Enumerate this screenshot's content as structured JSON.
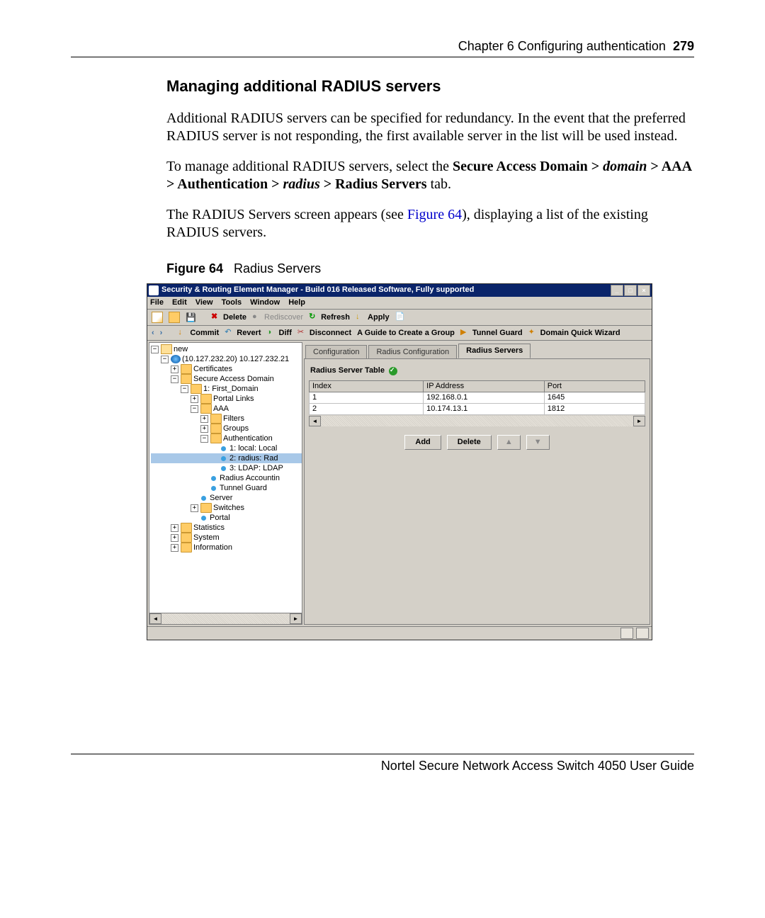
{
  "header": {
    "chapter": "Chapter 6  Configuring authentication",
    "pagenum": "279"
  },
  "section": {
    "title": "Managing additional RADIUS servers"
  },
  "para1": "Additional RADIUS servers can be specified for redundancy. In the event that the preferred RADIUS server is not responding, the first available server in the list will be used instead.",
  "para2_a": "To manage additional RADIUS servers, select the ",
  "para2_b1": "Secure Access Domain > ",
  "para2_b2": "domain",
  "para2_b3": " > AAA > Authentication > ",
  "para2_b4": "radius",
  "para2_b5": " > Radius Servers",
  "para2_b6": " tab.",
  "para3_a": "The RADIUS Servers screen appears (see ",
  "para3_ref": "Figure 64",
  "para3_b": "), displaying a list of the existing RADIUS servers.",
  "figure": {
    "num": "Figure 64",
    "title": "Radius Servers"
  },
  "footer": "Nortel Secure Network Access Switch 4050 User Guide",
  "app": {
    "title": "Security & Routing Element Manager - Build 016 Released Software, Fully supported",
    "menubar": [
      "File",
      "Edit",
      "View",
      "Tools",
      "Window",
      "Help"
    ],
    "toolbar1": {
      "delete": "Delete",
      "rediscover": "Rediscover",
      "refresh": "Refresh",
      "apply": "Apply"
    },
    "toolbar2": {
      "commit": "Commit",
      "revert": "Revert",
      "diff": "Diff",
      "disconnect": "Disconnect",
      "guide": "A Guide to Create a Group",
      "tunnel": "Tunnel Guard",
      "wizard": "Domain Quick Wizard"
    },
    "tree": {
      "root": "new",
      "device": "(10.127.232.20) 10.127.232.21",
      "certs": "Certificates",
      "sad": "Secure Access Domain",
      "domain": "1: First_Domain",
      "portal_links": "Portal Links",
      "aaa": "AAA",
      "filters": "Filters",
      "groups": "Groups",
      "auth": "Authentication",
      "auth1": "1: local: Local",
      "auth2": "2: radius: Rad",
      "auth3": "3: LDAP: LDAP",
      "radacct": "Radius Accountin",
      "tunguard": "Tunnel Guard",
      "server": "Server",
      "switches": "Switches",
      "portal": "Portal",
      "stats": "Statistics",
      "system": "System",
      "info": "Information"
    },
    "tabs": {
      "t1": "Configuration",
      "t2": "Radius Configuration",
      "t3": "Radius Servers"
    },
    "panel": {
      "label": "Radius Server Table",
      "cols": {
        "c1": "Index",
        "c2": "IP Address",
        "c3": "Port"
      },
      "rows": [
        {
          "idx": "1",
          "ip": "192.168.0.1",
          "port": "1645"
        },
        {
          "idx": "2",
          "ip": "10.174.13.1",
          "port": "1812"
        }
      ],
      "btns": {
        "add": "Add",
        "del": "Delete"
      }
    }
  }
}
